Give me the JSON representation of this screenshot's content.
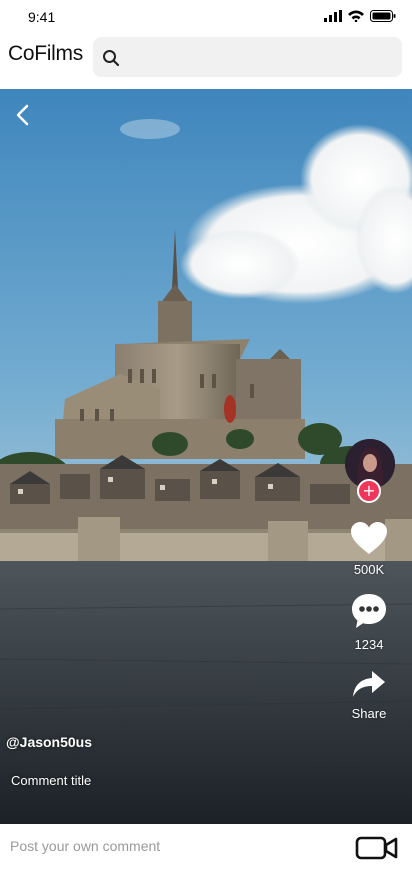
{
  "status_bar": {
    "time": "9:41",
    "icons": [
      "signal-icon",
      "wifi-icon",
      "battery-icon"
    ]
  },
  "header": {
    "app_title": "CoFilms",
    "search": {
      "placeholder": "",
      "icon": "search-icon"
    }
  },
  "video": {
    "back_icon": "chevron-left-icon",
    "creator": {
      "username": "@Jason50us",
      "follow_icon": "plus-icon",
      "follow_glyph": "+"
    },
    "actions": [
      {
        "name": "like",
        "icon": "heart-icon",
        "label": "500K"
      },
      {
        "name": "comment",
        "icon": "speech-bubble-icon",
        "label": "1234"
      },
      {
        "name": "share",
        "icon": "share-arrow-icon",
        "label": "Share"
      }
    ],
    "comment_title": "Comment title"
  },
  "comment_bar": {
    "placeholder": "Post your own comment",
    "camera_icon": "video-camera-icon"
  },
  "colors": {
    "follow_badge": "#f0365a",
    "sky": "#5c9cc7",
    "sand": "#343a40"
  }
}
